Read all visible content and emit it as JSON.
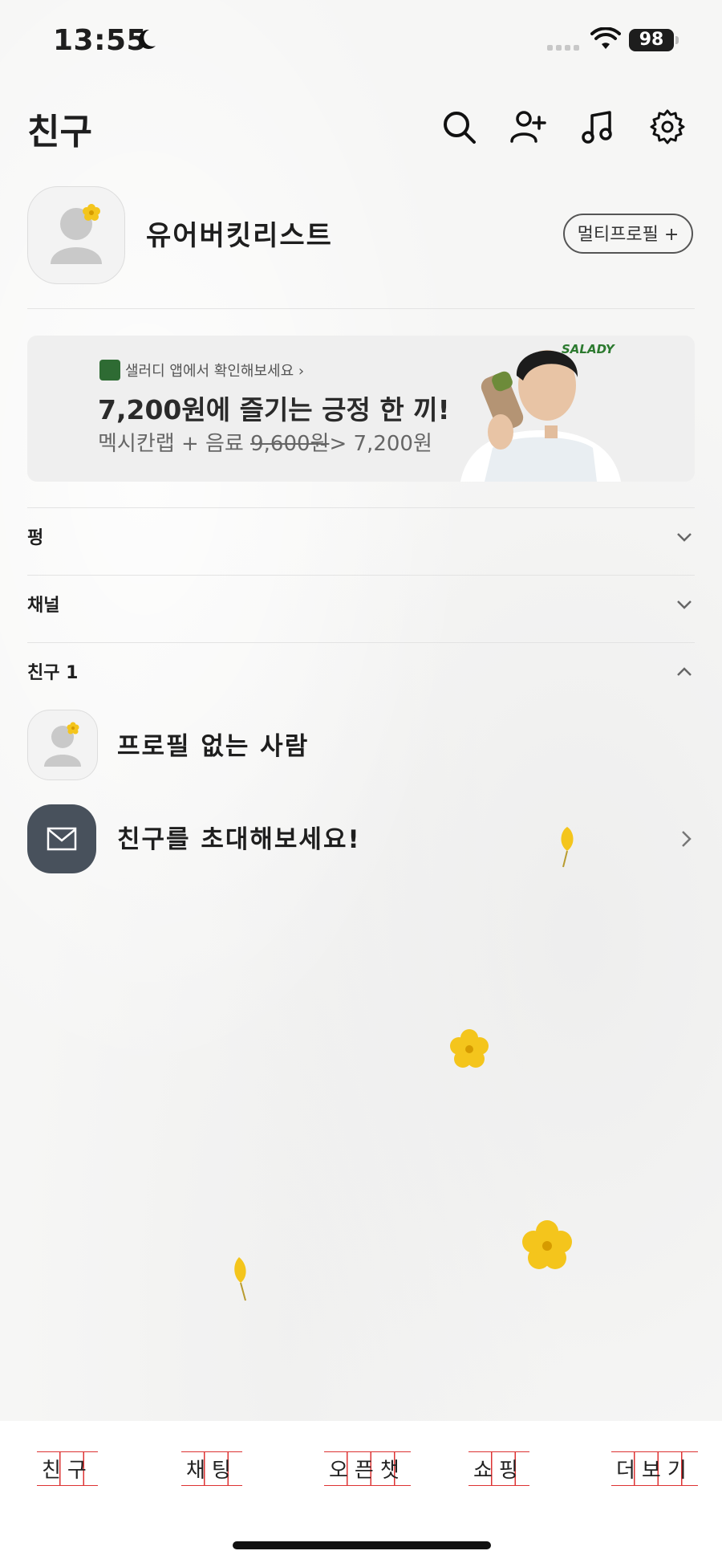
{
  "status_bar": {
    "time": "13:55",
    "battery": "98"
  },
  "header": {
    "title": "친구"
  },
  "profile": {
    "name": "유어버킷리스트",
    "multi_profile_label": "멀티프로필 +"
  },
  "ad": {
    "brand": "SALADY",
    "logo_text": "SALADY",
    "small_text": "샐러디 앱에서 확인해보세요 ›",
    "headline": "7,200원에 즐기는 긍정 한 끼!",
    "sub_prefix": "멕시칸랩 + 음료 ",
    "sub_old_price": "9,600원",
    "sub_new_price": "> 7,200원"
  },
  "sections": [
    {
      "label": "펑",
      "state": "collapsed"
    },
    {
      "label": "채널",
      "state": "collapsed"
    },
    {
      "label": "친구 1",
      "state": "expanded"
    }
  ],
  "friends": [
    {
      "name": "프로필 없는 사람"
    }
  ],
  "invite": {
    "label": "친구를 초대해보세요!"
  },
  "tabs": [
    "친구",
    "채팅",
    "오픈챗",
    "쇼핑",
    "더보기"
  ],
  "colors": {
    "accent_yellow": "#f4c51c",
    "invite_bg": "#48515c",
    "tab_grid": "#dd3333"
  }
}
